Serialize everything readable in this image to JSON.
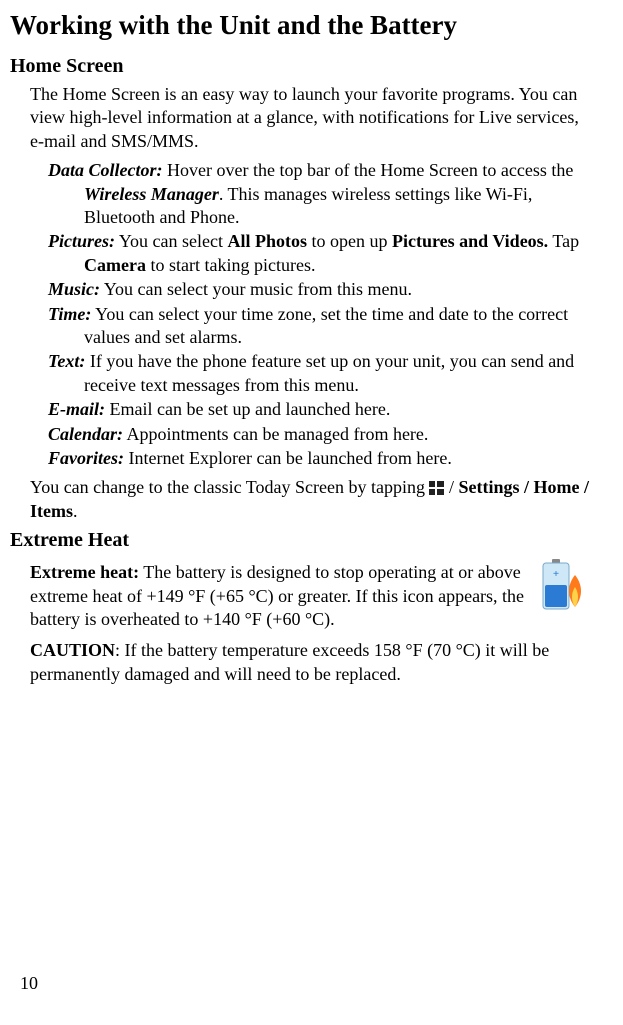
{
  "title": "Working with the Unit and the Battery",
  "home": {
    "heading": "Home Screen",
    "intro": "The Home Screen is an easy way to launch your favorite programs. You can view high-level information at a glance, with notifications for Live services, e-mail and SMS/MMS.",
    "items": {
      "dataCollector": {
        "label": "Data Collector:",
        "pre": " Hover over the top bar of the Home Screen to access the ",
        "boldItalic": "Wireless Manager",
        "post": ". This manages wireless settings like Wi-Fi, Bluetooth and Phone."
      },
      "pictures": {
        "label": "Pictures:",
        "t1": " You can select ",
        "b1": "All Photos",
        "t2": " to open up ",
        "b2": "Pictures and Videos.",
        "t3": " Tap ",
        "b3": "Camera",
        "t4": " to start taking pictures."
      },
      "music": {
        "label": "Music:",
        "text": " You can select your music from this menu."
      },
      "time": {
        "label": "Time:",
        "text": " You can select your time zone, set the time and date to the correct values and set alarms."
      },
      "textmsg": {
        "label": "Text:",
        "text": " If you have the phone feature set up on your unit, you can send and receive text messages from this menu."
      },
      "email": {
        "label": "E-mail:",
        "text": " Email can be set up and launched here."
      },
      "calendar": {
        "label": "Calendar:",
        "text": " Appointments can be managed from here."
      },
      "favorites": {
        "label": "Favorites:",
        "text": " Internet Explorer can be launched from here."
      }
    },
    "todayPre": "You can change to the classic Today Screen by tapping ",
    "todaySlash": "/ ",
    "todayBold": "Settings / Home / Items",
    "todayEnd": "."
  },
  "heat": {
    "heading": "Extreme Heat",
    "label": "Extreme heat:",
    "text": " The battery is designed to stop operating at or above extreme heat of +149 °F (+65 °C) or greater. If this icon appears, the battery is overheated to +140 °F (+60 °C).",
    "cautionLabel": "CAUTION",
    "cautionText": ": If the battery temperature exceeds 158 °F (70 °C) it will be permanently damaged and will need to be replaced."
  },
  "pageNumber": "10"
}
